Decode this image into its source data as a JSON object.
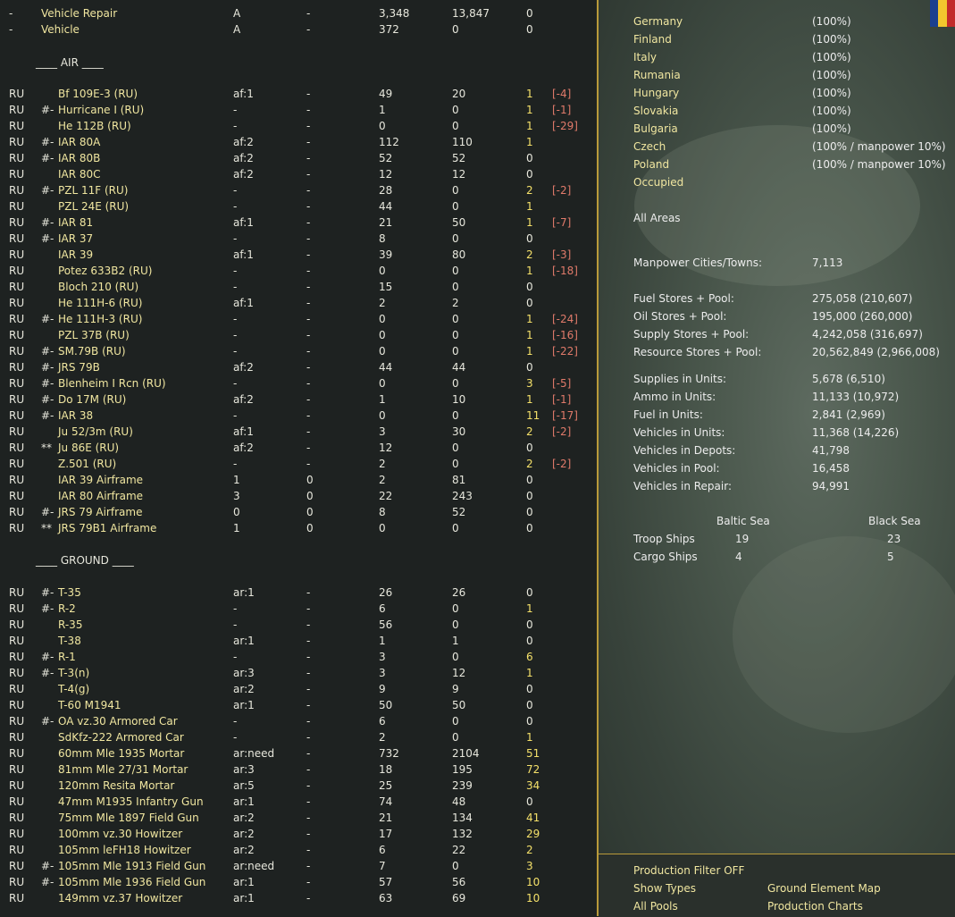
{
  "colors": {
    "accent_line": "#b99a3a",
    "name_yellow": "#f0e6a0",
    "value_highlight": "#f5e16a",
    "penalty_red": "#e07a6a"
  },
  "flag_colors": [
    "#1b3f8f",
    "#f2c62e",
    "#c22a2a"
  ],
  "vehicle_rows": [
    {
      "nat": "-",
      "name": "Vehicle Repair",
      "grp": "A",
      "dash": "-",
      "v1": "3,348",
      "v2": "13,847",
      "v3": "0"
    },
    {
      "nat": "-",
      "name": "Vehicle",
      "grp": "A",
      "dash": "-",
      "v1": "372",
      "v2": "0",
      "v3": "0"
    }
  ],
  "air_header": "____ AIR ____",
  "air_rows": [
    {
      "nat": "RU",
      "mark": "",
      "name": "Bf 109E-3 (RU)",
      "grp": "af:1",
      "dash": "-",
      "v1": "49",
      "v2": "20",
      "v3": "1",
      "hi": true,
      "pen": "[-4]"
    },
    {
      "nat": "RU",
      "mark": "#-",
      "name": "Hurricane I (RU)",
      "grp": "-",
      "dash": "-",
      "v1": "1",
      "v2": "0",
      "v3": "1",
      "hi": true,
      "pen": "[-1]"
    },
    {
      "nat": "RU",
      "mark": "",
      "name": "He 112B (RU)",
      "grp": "-",
      "dash": "-",
      "v1": "0",
      "v2": "0",
      "v3": "1",
      "hi": true,
      "pen": "[-29]"
    },
    {
      "nat": "RU",
      "mark": "#-",
      "name": "IAR 80A",
      "grp": "af:2",
      "dash": "-",
      "v1": "112",
      "v2": "110",
      "v3": "1",
      "hi": true,
      "pen": ""
    },
    {
      "nat": "RU",
      "mark": "#-",
      "name": "IAR 80B",
      "grp": "af:2",
      "dash": "-",
      "v1": "52",
      "v2": "52",
      "v3": "0",
      "hi": false,
      "pen": ""
    },
    {
      "nat": "RU",
      "mark": "",
      "name": "IAR 80C",
      "grp": "af:2",
      "dash": "-",
      "v1": "12",
      "v2": "12",
      "v3": "0",
      "hi": false,
      "pen": ""
    },
    {
      "nat": "RU",
      "mark": "#-",
      "name": "PZL 11F (RU)",
      "grp": "-",
      "dash": "-",
      "v1": "28",
      "v2": "0",
      "v3": "2",
      "hi": true,
      "pen": "[-2]"
    },
    {
      "nat": "RU",
      "mark": "",
      "name": "PZL 24E (RU)",
      "grp": "-",
      "dash": "-",
      "v1": "44",
      "v2": "0",
      "v3": "1",
      "hi": true,
      "pen": ""
    },
    {
      "nat": "RU",
      "mark": "#-",
      "name": "IAR 81",
      "grp": "af:1",
      "dash": "-",
      "v1": "21",
      "v2": "50",
      "v3": "1",
      "hi": true,
      "pen": "[-7]"
    },
    {
      "nat": "RU",
      "mark": "#-",
      "name": "IAR 37",
      "grp": "-",
      "dash": "-",
      "v1": "8",
      "v2": "0",
      "v3": "0",
      "hi": false,
      "pen": ""
    },
    {
      "nat": "RU",
      "mark": "",
      "name": "IAR 39",
      "grp": "af:1",
      "dash": "-",
      "v1": "39",
      "v2": "80",
      "v3": "2",
      "hi": true,
      "pen": "[-3]"
    },
    {
      "nat": "RU",
      "mark": "",
      "name": "Potez 633B2 (RU)",
      "grp": "-",
      "dash": "-",
      "v1": "0",
      "v2": "0",
      "v3": "1",
      "hi": true,
      "pen": "[-18]"
    },
    {
      "nat": "RU",
      "mark": "",
      "name": "Bloch 210 (RU)",
      "grp": "-",
      "dash": "-",
      "v1": "15",
      "v2": "0",
      "v3": "0",
      "hi": false,
      "pen": ""
    },
    {
      "nat": "RU",
      "mark": "",
      "name": "He 111H-6 (RU)",
      "grp": "af:1",
      "dash": "-",
      "v1": "2",
      "v2": "2",
      "v3": "0",
      "hi": false,
      "pen": ""
    },
    {
      "nat": "RU",
      "mark": "#-",
      "name": "He 111H-3 (RU)",
      "grp": "-",
      "dash": "-",
      "v1": "0",
      "v2": "0",
      "v3": "1",
      "hi": true,
      "pen": "[-24]"
    },
    {
      "nat": "RU",
      "mark": "",
      "name": "PZL 37B (RU)",
      "grp": "-",
      "dash": "-",
      "v1": "0",
      "v2": "0",
      "v3": "1",
      "hi": true,
      "pen": "[-16]"
    },
    {
      "nat": "RU",
      "mark": "#-",
      "name": "SM.79B (RU)",
      "grp": "-",
      "dash": "-",
      "v1": "0",
      "v2": "0",
      "v3": "1",
      "hi": true,
      "pen": "[-22]"
    },
    {
      "nat": "RU",
      "mark": "#-",
      "name": "JRS 79B",
      "grp": "af:2",
      "dash": "-",
      "v1": "44",
      "v2": "44",
      "v3": "0",
      "hi": false,
      "pen": ""
    },
    {
      "nat": "RU",
      "mark": "#-",
      "name": "Blenheim I Rcn (RU)",
      "grp": "-",
      "dash": "-",
      "v1": "0",
      "v2": "0",
      "v3": "3",
      "hi": true,
      "pen": "[-5]"
    },
    {
      "nat": "RU",
      "mark": "#-",
      "name": "Do 17M (RU)",
      "grp": "af:2",
      "dash": "-",
      "v1": "1",
      "v2": "10",
      "v3": "1",
      "hi": true,
      "pen": "[-1]"
    },
    {
      "nat": "RU",
      "mark": "#-",
      "name": "IAR 38",
      "grp": "-",
      "dash": "-",
      "v1": "0",
      "v2": "0",
      "v3": "11",
      "hi": true,
      "pen": "[-17]"
    },
    {
      "nat": "RU",
      "mark": "",
      "name": "Ju 52/3m (RU)",
      "grp": "af:1",
      "dash": "-",
      "v1": "3",
      "v2": "30",
      "v3": "2",
      "hi": true,
      "pen": "[-2]"
    },
    {
      "nat": "RU",
      "mark": "**",
      "name": "Ju 86E (RU)",
      "grp": "af:2",
      "dash": "-",
      "v1": "12",
      "v2": "0",
      "v3": "0",
      "hi": false,
      "pen": ""
    },
    {
      "nat": "RU",
      "mark": "",
      "name": "Z.501 (RU)",
      "grp": "-",
      "dash": "-",
      "v1": "2",
      "v2": "0",
      "v3": "2",
      "hi": true,
      "pen": "[-2]"
    },
    {
      "nat": "RU",
      "mark": "",
      "name": "IAR 39 Airframe",
      "grp": "1",
      "dash": "0",
      "v1": "2",
      "v2": "81",
      "v3": "0",
      "hi": false,
      "pen": ""
    },
    {
      "nat": "RU",
      "mark": "",
      "name": "IAR 80 Airframe",
      "grp": "3",
      "dash": "0",
      "v1": "22",
      "v2": "243",
      "v3": "0",
      "hi": false,
      "pen": ""
    },
    {
      "nat": "RU",
      "mark": "#-",
      "name": "JRS 79 Airframe",
      "grp": "0",
      "dash": "0",
      "v1": "8",
      "v2": "52",
      "v3": "0",
      "hi": false,
      "pen": ""
    },
    {
      "nat": "RU",
      "mark": "**",
      "name": "JRS 79B1 Airframe",
      "grp": "1",
      "dash": "0",
      "v1": "0",
      "v2": "0",
      "v3": "0",
      "hi": false,
      "pen": ""
    }
  ],
  "ground_header": "____ GROUND ____",
  "ground_rows": [
    {
      "nat": "RU",
      "mark": "#-",
      "name": "T-35",
      "grp": "ar:1",
      "dash": "-",
      "v1": "26",
      "v2": "26",
      "v3": "0",
      "hi": false,
      "pen": ""
    },
    {
      "nat": "RU",
      "mark": "#-",
      "name": "R-2",
      "grp": "-",
      "dash": "-",
      "v1": "6",
      "v2": "0",
      "v3": "1",
      "hi": true,
      "pen": ""
    },
    {
      "nat": "RU",
      "mark": "",
      "name": "R-35",
      "grp": "-",
      "dash": "-",
      "v1": "56",
      "v2": "0",
      "v3": "0",
      "hi": false,
      "pen": ""
    },
    {
      "nat": "RU",
      "mark": "",
      "name": "T-38",
      "grp": "ar:1",
      "dash": "-",
      "v1": "1",
      "v2": "1",
      "v3": "0",
      "hi": false,
      "pen": ""
    },
    {
      "nat": "RU",
      "mark": "#-",
      "name": "R-1",
      "grp": "-",
      "dash": "-",
      "v1": "3",
      "v2": "0",
      "v3": "6",
      "hi": true,
      "pen": ""
    },
    {
      "nat": "RU",
      "mark": "#-",
      "name": "T-3(n)",
      "grp": "ar:3",
      "dash": "-",
      "v1": "3",
      "v2": "12",
      "v3": "1",
      "hi": true,
      "pen": ""
    },
    {
      "nat": "RU",
      "mark": "",
      "name": "T-4(g)",
      "grp": "ar:2",
      "dash": "-",
      "v1": "9",
      "v2": "9",
      "v3": "0",
      "hi": false,
      "pen": ""
    },
    {
      "nat": "RU",
      "mark": "",
      "name": "T-60 M1941",
      "grp": "ar:1",
      "dash": "-",
      "v1": "50",
      "v2": "50",
      "v3": "0",
      "hi": false,
      "pen": ""
    },
    {
      "nat": "RU",
      "mark": "#-",
      "name": "OA vz.30 Armored Car",
      "grp": "-",
      "dash": "-",
      "v1": "6",
      "v2": "0",
      "v3": "0",
      "hi": false,
      "pen": ""
    },
    {
      "nat": "RU",
      "mark": "",
      "name": "SdKfz-222 Armored Car",
      "grp": "-",
      "dash": "-",
      "v1": "2",
      "v2": "0",
      "v3": "1",
      "hi": true,
      "pen": ""
    },
    {
      "nat": "RU",
      "mark": "",
      "name": "60mm Mle 1935 Mortar",
      "grp": "ar:need",
      "dash": "-",
      "v1": "732",
      "v2": "2104",
      "v3": "51",
      "hi": true,
      "pen": ""
    },
    {
      "nat": "RU",
      "mark": "",
      "name": "81mm Mle 27/31 Mortar",
      "grp": "ar:3",
      "dash": "-",
      "v1": "18",
      "v2": "195",
      "v3": "72",
      "hi": true,
      "pen": ""
    },
    {
      "nat": "RU",
      "mark": "",
      "name": "120mm Resita Mortar",
      "grp": "ar:5",
      "dash": "-",
      "v1": "25",
      "v2": "239",
      "v3": "34",
      "hi": true,
      "pen": ""
    },
    {
      "nat": "RU",
      "mark": "",
      "name": "47mm M1935 Infantry Gun",
      "grp": "ar:1",
      "dash": "-",
      "v1": "74",
      "v2": "48",
      "v3": "0",
      "hi": false,
      "pen": ""
    },
    {
      "nat": "RU",
      "mark": "",
      "name": "75mm Mle 1897 Field Gun",
      "grp": "ar:2",
      "dash": "-",
      "v1": "21",
      "v2": "134",
      "v3": "41",
      "hi": true,
      "pen": ""
    },
    {
      "nat": "RU",
      "mark": "",
      "name": "100mm vz.30 Howitzer",
      "grp": "ar:2",
      "dash": "-",
      "v1": "17",
      "v2": "132",
      "v3": "29",
      "hi": true,
      "pen": ""
    },
    {
      "nat": "RU",
      "mark": "",
      "name": "105mm leFH18 Howitzer",
      "grp": "ar:2",
      "dash": "-",
      "v1": "6",
      "v2": "22",
      "v3": "2",
      "hi": true,
      "pen": ""
    },
    {
      "nat": "RU",
      "mark": "#-",
      "name": "105mm Mle 1913 Field Gun",
      "grp": "ar:need",
      "dash": "-",
      "v1": "7",
      "v2": "0",
      "v3": "3",
      "hi": true,
      "pen": ""
    },
    {
      "nat": "RU",
      "mark": "#-",
      "name": "105mm Mle 1936 Field Gun",
      "grp": "ar:1",
      "dash": "-",
      "v1": "57",
      "v2": "56",
      "v3": "10",
      "hi": true,
      "pen": ""
    },
    {
      "nat": "RU",
      "mark": "",
      "name": "149mm vz.37 Howitzer",
      "grp": "ar:1",
      "dash": "-",
      "v1": "63",
      "v2": "69",
      "v3": "10",
      "hi": true,
      "pen": ""
    }
  ],
  "areas": [
    {
      "label": "Germany",
      "value": "(100%)"
    },
    {
      "label": "Finland",
      "value": "(100%)"
    },
    {
      "label": "Italy",
      "value": "(100%)"
    },
    {
      "label": "Rumania",
      "value": "(100%)"
    },
    {
      "label": "Hungary",
      "value": "(100%)"
    },
    {
      "label": "Slovakia",
      "value": "(100%)"
    },
    {
      "label": "Bulgaria",
      "value": "(100%)"
    },
    {
      "label": "Czech",
      "value": "(100% / manpower 10%)"
    },
    {
      "label": "Poland",
      "value": "(100% / manpower 10%)"
    },
    {
      "label": "Occupied",
      "value": ""
    }
  ],
  "all_areas_label": "All Areas",
  "manpower": {
    "label": "Manpower Cities/Towns:",
    "value": "7,113"
  },
  "stores": [
    {
      "label": "Fuel Stores + Pool:",
      "value": "275,058 (210,607)"
    },
    {
      "label": "Oil Stores + Pool:",
      "value": "195,000 (260,000)"
    },
    {
      "label": "Supply Stores + Pool:",
      "value": "4,242,058 (316,697)"
    },
    {
      "label": "Resource Stores + Pool:",
      "value": "20,562,849 (2,966,008)"
    }
  ],
  "units": [
    {
      "label": "Supplies in Units:",
      "value": "5,678 (6,510)"
    },
    {
      "label": "Ammo in Units:",
      "value": "11,133 (10,972)"
    },
    {
      "label": "Fuel in Units:",
      "value": "2,841 (2,969)"
    },
    {
      "label": "Vehicles in Units:",
      "value": "11,368 (14,226)"
    },
    {
      "label": "Vehicles in Depots:",
      "value": "41,798"
    },
    {
      "label": "Vehicles in Pool:",
      "value": "16,458"
    },
    {
      "label": "Vehicles in Repair:",
      "value": "94,991"
    }
  ],
  "seas": {
    "headers": [
      "Baltic Sea",
      "Black Sea"
    ],
    "rows": [
      {
        "label": "Troop Ships",
        "baltic": "19",
        "black": "23"
      },
      {
        "label": "Cargo Ships",
        "baltic": "4",
        "black": "5"
      }
    ]
  },
  "bottom_links": {
    "production_filter": "Production Filter OFF",
    "show_types": "Show Types",
    "all_pools": "All Pools",
    "ground_element_map": "Ground Element Map",
    "production_charts": "Production Charts"
  }
}
